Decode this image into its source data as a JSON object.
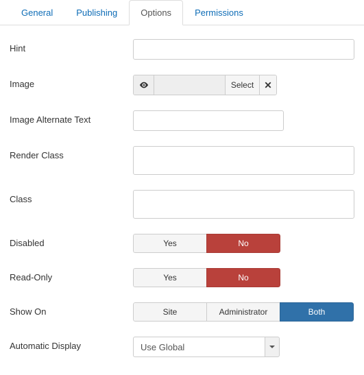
{
  "tabs": {
    "general": "General",
    "publishing": "Publishing",
    "options": "Options",
    "permissions": "Permissions"
  },
  "labels": {
    "hint": "Hint",
    "image": "Image",
    "image_alt": "Image Alternate Text",
    "render_class": "Render Class",
    "class": "Class",
    "disabled": "Disabled",
    "read_only": "Read-Only",
    "show_on": "Show On",
    "auto_display": "Automatic Display"
  },
  "values": {
    "hint": "",
    "image_path": "",
    "image_alt": "",
    "render_class": "",
    "class": "",
    "auto_display": "Use Global"
  },
  "buttons": {
    "select": "Select",
    "yes": "Yes",
    "no": "No",
    "site": "Site",
    "administrator": "Administrator",
    "both": "Both"
  }
}
